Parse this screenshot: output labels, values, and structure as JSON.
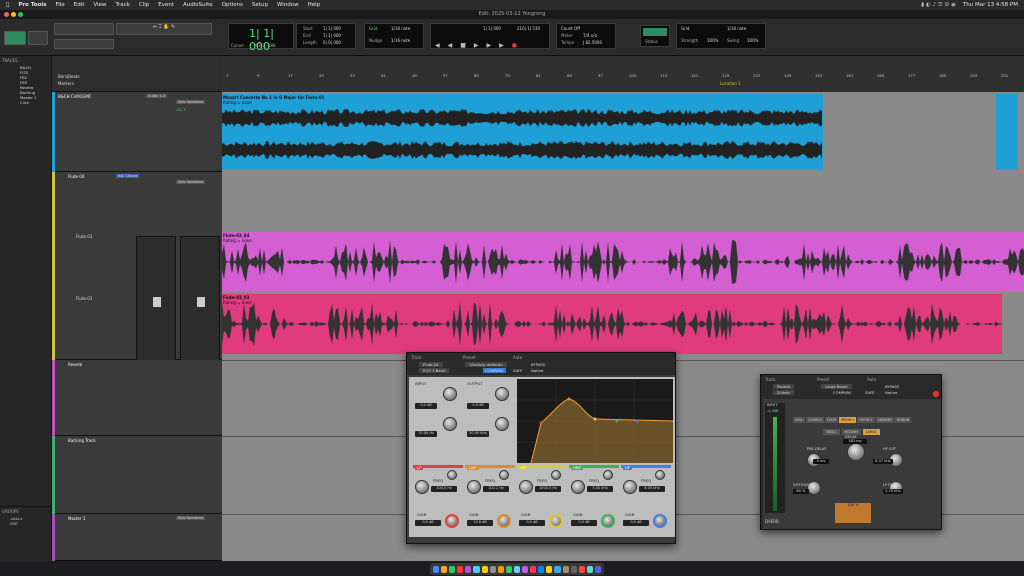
{
  "menubar": {
    "apple": "",
    "app": "Pro Tools",
    "items": [
      "File",
      "Edit",
      "View",
      "Track",
      "Clip",
      "Event",
      "AudioSuite",
      "Options",
      "Setup",
      "Window",
      "Help"
    ],
    "clock": "Thu Mar 13  4:58 PM"
  },
  "window_title": "Edit: 2025-03-12 Yongrong",
  "toolbar": {
    "main_counter": "1| 1| 000",
    "cursor_label": "Cursor",
    "cursor_value": "93| 2| 588",
    "start": "1| 1| 000",
    "end": "1| 1| 000",
    "length": "0| 0| 000",
    "start_label": "Start",
    "end_label": "End",
    "length_label": "Length",
    "grid_label": "Grid",
    "grid_value": "1/16 note",
    "nudge_label": "Nudge",
    "nudge_value": "1/16 note",
    "transport_start": "1| 1| 000",
    "transport_end": "216| 1| 530",
    "count_off": "Count Off",
    "tempo_label": "Tempo",
    "tempo_value": "J 82.5000",
    "meter_label": "Meter",
    "meter_value": "7/4 n/a",
    "status_label": "Status",
    "zoom_pct": "100%",
    "swing_pct": "100%",
    "strength_label": "Strength",
    "swing_label": "Swing"
  },
  "left_panel": {
    "tracks_header": "TRACKS",
    "tracks": [
      "B&CH",
      "FLTE",
      "FB2",
      "FB3",
      "Reverb",
      "Backing",
      "Master 1",
      "Click"
    ],
    "groups_header": "GROUPS",
    "groups": [
      "<ALL>",
      "VCE"
    ]
  },
  "timeline": {
    "ruler_labels": [
      "Bars|Beats",
      "Markers"
    ],
    "bars": [
      "1",
      "9",
      "17",
      "25",
      "33",
      "41",
      "49",
      "57",
      "65",
      "73",
      "81",
      "89",
      "97",
      "105",
      "113",
      "121",
      "129",
      "137",
      "145",
      "153",
      "161",
      "169",
      "177",
      "185",
      "193",
      "201"
    ],
    "location": "Location 1"
  },
  "tracks": [
    {
      "name": "B&CH CnM1GMF",
      "io": "In-Bln 1-2",
      "output": "Solo Speakers",
      "vol": "-21.7",
      "pan": "100 100",
      "clip": "Mozart Concerto No 1 in G Major for Flute-01",
      "rating": "Rating = none",
      "color": "#1e9fd6"
    },
    {
      "name": "Flute.04",
      "io": "IN2 T-Band",
      "output": "Solo Speakers",
      "vol": "-73",
      "pan": "100 100",
      "clip": "",
      "rating": "",
      "color": "#c8c84a"
    },
    {
      "name": "Flute.03",
      "io": "",
      "output": "",
      "vol": "",
      "pan": "",
      "clip": "Flute-03_04",
      "rating": "Rating = none",
      "color": "#d35fd3"
    },
    {
      "name": "Flute.03",
      "io": "",
      "output": "",
      "vol": "",
      "pan": "",
      "clip": "Flute-03_03",
      "rating": "Rating = none",
      "color": "#e03b7f"
    },
    {
      "name": "Reverb",
      "io": "",
      "output": "",
      "vol": "",
      "pan": "",
      "clip": "",
      "rating": "",
      "color": "#c050c0"
    },
    {
      "name": "Backing Track",
      "io": "",
      "output": "",
      "vol": "",
      "pan": "",
      "clip": "",
      "rating": "",
      "color": "#40b070"
    },
    {
      "name": "Master 1",
      "io": "",
      "output": "Solo Speakers",
      "vol": "",
      "pan": "",
      "clip": "",
      "rating": "",
      "color": "#a050c0"
    }
  ],
  "eq_plugin": {
    "track_label": "Track",
    "preset_label": "Preset",
    "auto_label": "Auto",
    "track_value": "Flute.04",
    "preset_value": "<factory default>",
    "insert": "EQ3 7-Band",
    "compare": "COMPARE",
    "safe": "SAFE",
    "bypass": "BYPASS",
    "native": "Native",
    "input_label": "INPUT",
    "output_label": "OUTPUT",
    "input_val": "0.0 dB",
    "output_val": "0.0 dB",
    "hpf_freq": "70.00 Hz",
    "lpf_freq": "20.00 kHz",
    "bands": [
      {
        "name": "LF",
        "freq": "100.0 Hz",
        "gain": "0.0 dB",
        "color": "#e04040"
      },
      {
        "name": "LMF",
        "freq": "102.2 Hz",
        "gain": "10.6 dB",
        "color": "#e08a30"
      },
      {
        "name": "MF",
        "freq": "1000.0 Hz",
        "gain": "0.0 dB",
        "color": "#e0c830"
      },
      {
        "name": "HMF",
        "freq": "3.00 kHz",
        "gain": "0.0 dB",
        "color": "#40b050"
      },
      {
        "name": "HF",
        "freq": "6.00 kHz",
        "gain": "0.0 dB",
        "color": "#4080e0"
      }
    ],
    "freq_label": "FREQ",
    "gain_label": "GAIN",
    "q_label": "Q",
    "q_vals": [
      "1.00",
      "1.00",
      "1.00",
      "1.00",
      "1.00"
    ]
  },
  "reverb_plugin": {
    "track_label": "Track",
    "preset_label": "Preset",
    "auto_label": "Auto",
    "track_value": "Reverb",
    "preset_value": "Large Room",
    "insert": "D-Verb",
    "compare": "COMPARE",
    "safe": "SAFE",
    "bypass": "BYPASS",
    "native": "Native",
    "algorithms": [
      "HALL",
      "CHURCH",
      "PLATE",
      "ROOM 1",
      "ROOM 2",
      "AMBIENT",
      "NONLIN"
    ],
    "sizes": [
      "SMALL",
      "MEDIUM",
      "LARGE"
    ],
    "decay_label": "DECAY",
    "decay_val": "583 ms",
    "predelay_label": "PRE-DELAY",
    "predelay_val": "0 ms",
    "hfcut_label": "HF CUT",
    "hfcut_val": "8.47 kHz",
    "diffusion_label": "DIFFUSION",
    "diffusion_val": "80 %",
    "lpf_label": "LP FILTER",
    "lpf_val": "3.70 kHz",
    "input_label": "INPUT",
    "input_val": "-4.0dB",
    "mix_val": "100 %",
    "logo": "DVERB"
  },
  "colors": {
    "accent": "#1e9fd6",
    "eq_bg": "#bdbdbd",
    "reverb_bg": "#333333"
  }
}
